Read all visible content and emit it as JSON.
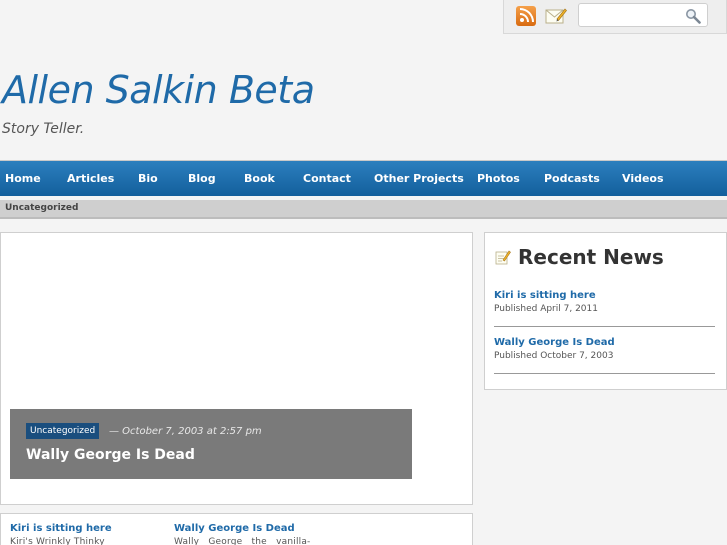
{
  "topbar": {
    "rss_icon": "rss-icon",
    "email_icon": "email-icon",
    "search_icon": "search-icon",
    "search_value": ""
  },
  "header": {
    "title": "Allen Salkin Beta",
    "tagline": "Story Teller."
  },
  "nav": {
    "items": [
      "Home",
      "Articles",
      "Bio",
      "Blog",
      "Book",
      "Contact",
      "Other Projects",
      "Photos",
      "Podcasts",
      "Videos"
    ]
  },
  "subnav": {
    "label": "Uncategorized"
  },
  "featured": {
    "category": "Uncategorized",
    "meta": "— October 7, 2003 at 2:57 pm",
    "title": "Wally George Is Dead"
  },
  "sidebar": {
    "heading": "Recent News",
    "items": [
      {
        "title": "Kiri is sitting here",
        "published": "Published April 7, 2011"
      },
      {
        "title": "Wally George Is Dead",
        "published": "Published October 7, 2003"
      }
    ]
  },
  "bottom": {
    "posts": [
      {
        "title": "Kiri is sitting here",
        "excerpt": "Kiri's Wrinkly Thinky"
      },
      {
        "title": "Wally George Is Dead",
        "excerpt": "Wally   George   the   vanilla-"
      }
    ]
  },
  "colors": {
    "nav_blue": "#1f6fae",
    "link_blue": "#1f6aa8",
    "tag_navy": "#1a4e7e"
  }
}
